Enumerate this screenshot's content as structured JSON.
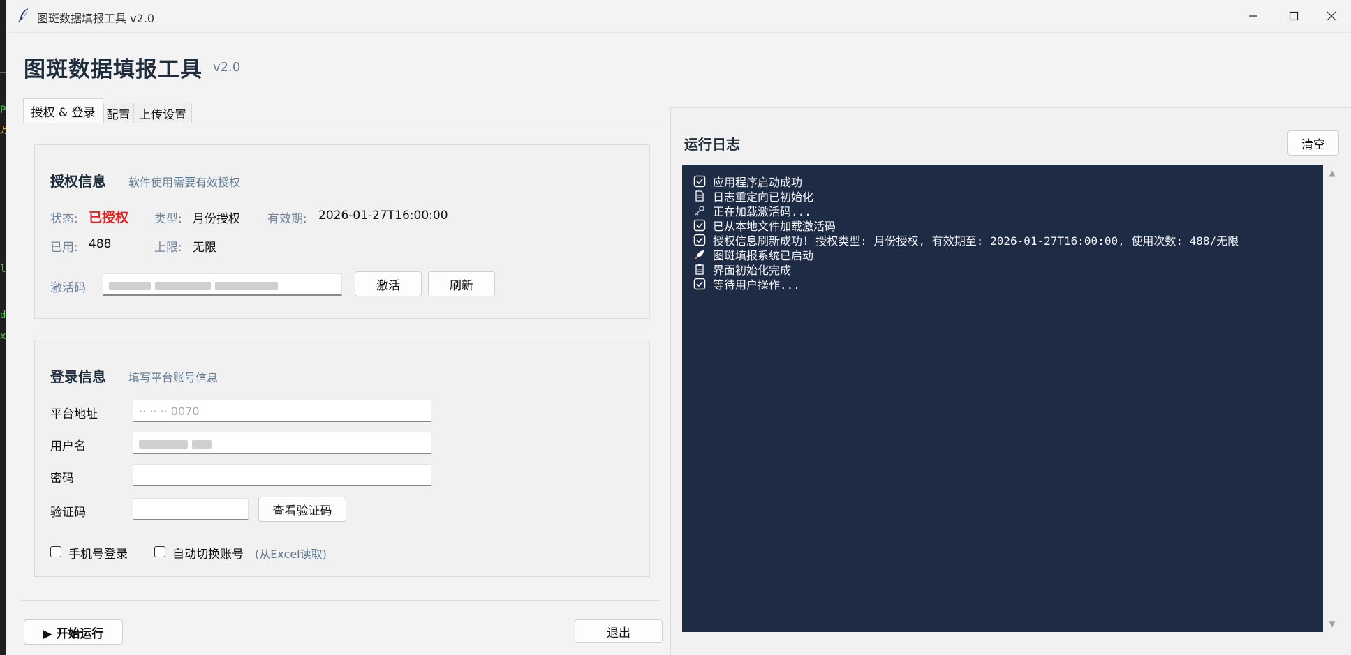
{
  "window": {
    "title": "图斑数据填报工具 v2.0",
    "controls": [
      "minimize-icon",
      "maximize-icon",
      "close-icon"
    ]
  },
  "header": {
    "title": "图斑数据填报工具",
    "version": "v2.0"
  },
  "tabs": [
    {
      "label": "授权 & 登录",
      "active": true
    },
    {
      "label": "配置",
      "active": false
    },
    {
      "label": "上传设置",
      "active": false
    }
  ],
  "auth": {
    "title": "授权信息",
    "subtitle": "软件使用需要有效授权",
    "status_label": "状态:",
    "status_value": "已授权",
    "type_label": "类型:",
    "type_value": "月份授权",
    "expiry_label": "有效期:",
    "expiry_value": "2026-01-27T16:00:00",
    "used_label": "已用:",
    "used_value": "488",
    "limit_label": "上限:",
    "limit_value": "无限",
    "code_label": "激活码",
    "activate_button": "激活",
    "refresh_button": "刷新"
  },
  "login": {
    "title": "登录信息",
    "subtitle": "填写平台账号信息",
    "platform_label": "平台地址",
    "platform_value": "·· ·· ·· 0070",
    "username_label": "用户名",
    "password_label": "密码",
    "captcha_label": "验证码",
    "captcha_button": "查看验证码",
    "phone_login_label": "手机号登录",
    "auto_switch_label": "自动切换账号",
    "auto_switch_hint": "(从Excel读取)"
  },
  "footer": {
    "start_button": "▶ 开始运行",
    "exit_button": "退出"
  },
  "log": {
    "title": "运行日志",
    "clear_button": "清空",
    "lines": [
      {
        "icon": "check-box-icon",
        "text": "应用程序启动成功"
      },
      {
        "icon": "document-icon",
        "text": "日志重定向已初始化"
      },
      {
        "icon": "key-icon",
        "text": "正在加载激活码..."
      },
      {
        "icon": "check-box-icon",
        "text": "已从本地文件加载激活码"
      },
      {
        "icon": "check-box-icon",
        "text": "授权信息刷新成功! 授权类型: 月份授权, 有效期至: 2026-01-27T16:00:00, 使用次数: 488/无限"
      },
      {
        "icon": "rocket-icon",
        "text": "图斑填报系统已启动"
      },
      {
        "icon": "clipboard-icon",
        "text": "界面初始化完成"
      },
      {
        "icon": "check-box-icon",
        "text": "等待用户操作..."
      }
    ]
  },
  "colors": {
    "log_background": "#1e2b45",
    "status_authorized": "#e52222",
    "label_muted": "#6f86a0",
    "heading": "#1f2d3d"
  }
}
